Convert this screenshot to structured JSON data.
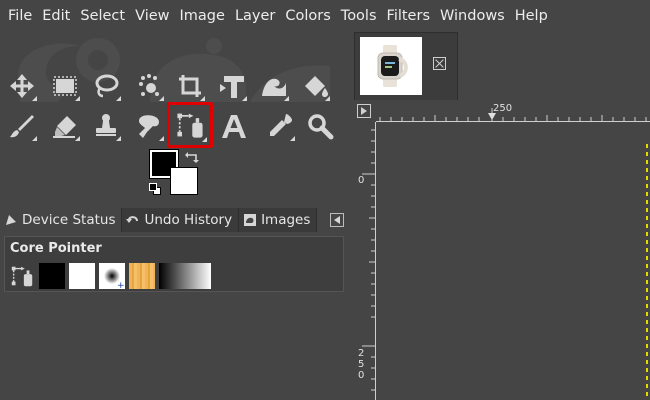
{
  "menubar": {
    "items": [
      "File",
      "Edit",
      "Select",
      "View",
      "Image",
      "Layer",
      "Colors",
      "Tools",
      "Filters",
      "Windows",
      "Help"
    ]
  },
  "toolbox": {
    "tools": [
      {
        "icon": "move-icon"
      },
      {
        "icon": "rect-select-icon"
      },
      {
        "icon": "lasso-icon"
      },
      {
        "icon": "fuzzy-select-icon"
      },
      {
        "icon": "crop-icon"
      },
      {
        "icon": "unified-transform-icon"
      },
      {
        "icon": "warp-transform-icon"
      },
      {
        "icon": "bucket-fill-icon"
      },
      {
        "icon": "paintbrush-icon"
      },
      {
        "icon": "eraser-icon"
      },
      {
        "icon": "clone-stamp-icon"
      },
      {
        "icon": "smudge-icon"
      },
      {
        "icon": "paths-icon",
        "selected": true
      },
      {
        "icon": "text-icon"
      },
      {
        "icon": "color-picker-icon"
      },
      {
        "icon": "zoom-icon"
      }
    ],
    "foreground_color": "#000000",
    "background_color": "#ffffff",
    "highlight_color": "#e00000"
  },
  "dock_tabs": {
    "tabs": [
      "Device Status",
      "Undo History",
      "Images"
    ]
  },
  "device_status": {
    "title": "Core Pointer"
  },
  "image_tab": {
    "thumbnail": "smartwatch-thumbnail"
  },
  "rulers": {
    "h_label": "250",
    "v_label_top": "0",
    "v_label_bottom": [
      "2",
      "5",
      "0"
    ]
  }
}
